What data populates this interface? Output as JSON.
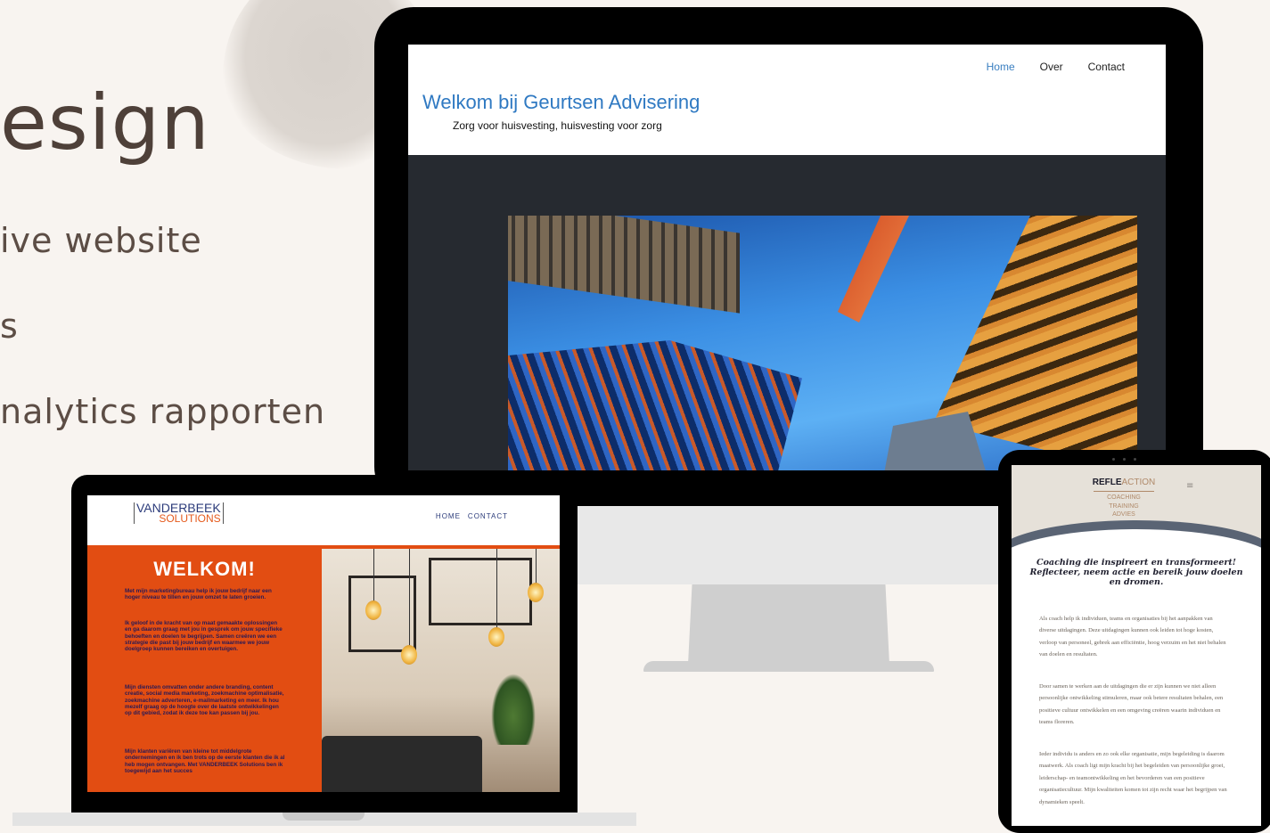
{
  "promo": {
    "heading": "esign",
    "features": [
      "ive website",
      "s",
      "nalytics rapporten"
    ]
  },
  "desktop_site": {
    "nav": [
      "Home",
      "Over",
      "Contact"
    ],
    "active_nav": "Home",
    "title": "Welkom bij Geurtsen Advisering",
    "tagline": "Zorg voor huisvesting, huisvesting voor zorg",
    "colors": {
      "title": "#2f79c2",
      "body_bg": "#262a30"
    }
  },
  "laptop_site": {
    "logo_line1": "VANDERBEEK",
    "logo_line2": "SOLUTIONS",
    "nav": [
      "HOME",
      "CONTACT"
    ],
    "welcome": "WELKOM!",
    "paragraphs": [
      "Met mijn marketingbureau help ik jouw bedrijf naar een hoger niveau te tillen en jouw omzet te laten groeien.",
      "Ik geloof in de kracht van op maat gemaakte oplossingen en ga daarom graag met jou in gesprek om jouw specifieke behoeften en doelen te begrijpen. Samen creëren we een strategie die past bij jouw bedrijf en waarmee we jouw doelgroep kunnen bereiken en overtuigen.",
      "Mijn diensten omvatten onder andere branding, content creatie, social media marketing, zoekmachine optimalisatie, zoekmachine adverteren, e-mailmarketing en meer. Ik hou mezelf graag op de hoogte over de laatste ontwikkelingen op dit gebied, zodat ik deze toe kan passen bij jou.",
      "Mijn klanten variëren van kleine tot middelgrote ondernemingen en ik ben trots op de eerste klanten die ik al heb mogen ontvangen. Met VANDERBEEK Solutions ben ik toegewijd aan het succes"
    ],
    "colors": {
      "accent": "#e24d12",
      "logo": "#2b3b7a"
    }
  },
  "tablet_site": {
    "logo_part1": "REFLE",
    "logo_part2": "ACTION",
    "subtitle": [
      "COACHING",
      "TRAINING",
      "ADVIES"
    ],
    "menu_icon": "hamburger-icon",
    "heading": "Coaching die inspireert en transformeert! Reflecteer, neem actie en bereik jouw doelen en dromen.",
    "paragraphs": [
      "Als coach help ik individuen, teams en organisaties bij het aanpakken van diverse uitdagingen. Deze uitdagingen kunnen ook leiden tot hoge kosten, verloop van personeel, gebrek aan efficiëntie, hoog verzuim en het niet behalen van doelen en resultaten.",
      "Door samen te werken aan de uitdagingen die er zijn kunnen we niet alleen persoonlijke ontwikkeling stimuleren, maar ook betere resultaten behalen, een positieve cultuur ontwikkelen en een omgeving creëren waarin individuen en teams floreren.",
      "Ieder individu is anders en zo ook elke organisatie, mijn begeleiding is daarom maatwerk. Als coach ligt mijn kracht bij het begeleiden van persoonlijke groei, leiderschap- en teamontwikkeling en het bevorderen van een positieve organisatiecultuur. Mijn kwaliteiten komen tot zijn recht waar het begrijpen van dynamieken speelt."
    ]
  }
}
